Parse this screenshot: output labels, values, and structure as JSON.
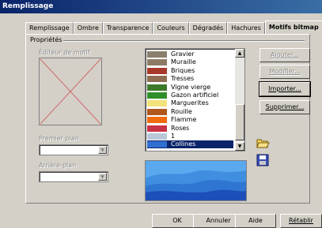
{
  "window": {
    "title": "Remplissage"
  },
  "tabs": [
    {
      "label": "Remplissage"
    },
    {
      "label": "Ombre"
    },
    {
      "label": "Transparence"
    },
    {
      "label": "Couleurs"
    },
    {
      "label": "Dégradés"
    },
    {
      "label": "Hachures"
    },
    {
      "label": "Motifs bitmap"
    }
  ],
  "active_tab": "Motifs bitmap",
  "properties": {
    "group_label": "Propriétés",
    "editor_label": "Éditeur de motif",
    "foreground_label": "Premier plan",
    "background_label": "Arrière-plan",
    "foreground_value": "",
    "background_value": ""
  },
  "bitmap_list": {
    "items": [
      {
        "label": "Gravier",
        "swatch": "#8a7f6c"
      },
      {
        "label": "Muraille",
        "swatch": "#8e7a62"
      },
      {
        "label": "Briques",
        "swatch": "#a8382a"
      },
      {
        "label": "Tresses",
        "swatch": "#8f6d52"
      },
      {
        "label": "Vigne vierge",
        "swatch": "#3c7a2a"
      },
      {
        "label": "Gazon artificiel",
        "swatch": "#2f8f2a"
      },
      {
        "label": "Marguerites",
        "swatch": "#f2e27a"
      },
      {
        "label": "Rouille",
        "swatch": "#b0561c"
      },
      {
        "label": "Flamme",
        "swatch": "#f06a10"
      },
      {
        "label": "Roses",
        "swatch": "#c83246"
      },
      {
        "label": "1",
        "swatch": "#b8c8d8"
      },
      {
        "label": "Collines",
        "swatch": "#2f6fd0"
      }
    ],
    "selected": "Collines"
  },
  "buttons": {
    "add": "Ajouter...",
    "modify": "Modifier...",
    "import": "Importer...",
    "delete": "Supprimer..."
  },
  "icons": {
    "open": "folder-open-icon",
    "save": "save-disk-icon"
  },
  "preview": {
    "pattern": "Collines",
    "colors": [
      "#1d4fb8",
      "#3f8ee0",
      "#5aa8ee"
    ]
  },
  "footer": {
    "ok": "OK",
    "cancel": "Annuler",
    "help": "Aide",
    "reset": "Rétablir"
  }
}
